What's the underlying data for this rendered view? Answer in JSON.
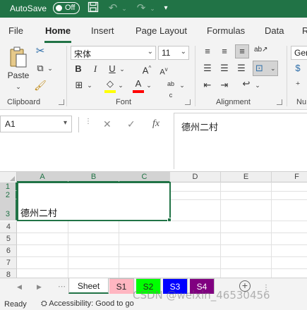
{
  "titlebar": {
    "autosave_label": "AutoSave",
    "autosave_state": "Off"
  },
  "ribbon_tabs": [
    "File",
    "Home",
    "Insert",
    "Page Layout",
    "Formulas",
    "Data",
    "R"
  ],
  "active_tab": "Home",
  "ribbon": {
    "clipboard": {
      "paste_label": "Paste",
      "group_label": "Clipboard"
    },
    "font": {
      "font_name": "宋体",
      "font_size": "11",
      "group_label": "Font"
    },
    "alignment": {
      "group_label": "Alignment"
    },
    "number": {
      "format_partial": "Gen",
      "group_label": "Nu"
    }
  },
  "formula_bar": {
    "name_box": "A1",
    "fx_label": "fx",
    "content": "德州二村"
  },
  "grid": {
    "columns": [
      "A",
      "B",
      "C",
      "D",
      "E",
      "F"
    ],
    "selected_columns": [
      "A",
      "B",
      "C"
    ],
    "rows": [
      "1",
      "2",
      "3",
      "4",
      "5",
      "6",
      "7",
      "8"
    ],
    "selected_rows": [
      "1",
      "2",
      "3"
    ],
    "merged_cell_text": "德州二村"
  },
  "sheets": [
    {
      "name": "Sheet",
      "color": "#ffffff",
      "active": true
    },
    {
      "name": "S1",
      "color": "#ffb6c1",
      "active": false
    },
    {
      "name": "S2",
      "color": "#00ff00",
      "active": false
    },
    {
      "name": "S3",
      "color": "#0000ff",
      "active": false
    },
    {
      "name": "S4",
      "color": "#800080",
      "active": false
    }
  ],
  "statusbar": {
    "ready": "Ready",
    "accessibility": "Accessibility: Good to go"
  },
  "watermark": "CSDN @weixin_46530456",
  "colors": {
    "excel_green": "#217346",
    "highlight_yellow": "#ffff00",
    "font_red": "#ff0000"
  }
}
